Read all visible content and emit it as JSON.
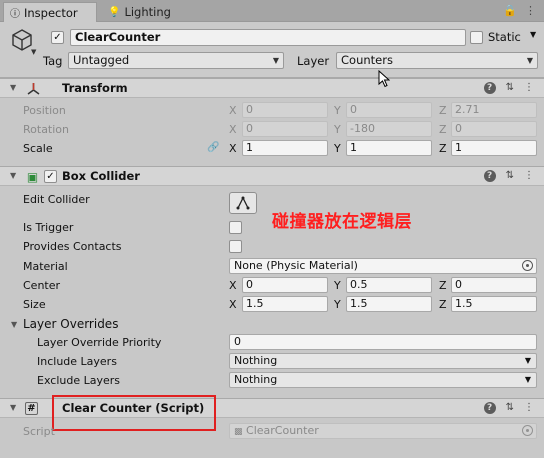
{
  "tabs": [
    {
      "label": "Inspector",
      "icon": "info-icon"
    },
    {
      "label": "Lighting",
      "icon": "light-bulb-icon"
    }
  ],
  "object": {
    "active_checked": true,
    "name": "ClearCounter",
    "static_label": "Static",
    "static_checked": false,
    "tag_label": "Tag",
    "tag_value": "Untagged",
    "layer_label": "Layer",
    "layer_value": "Counters"
  },
  "transform": {
    "title": "Transform",
    "position": {
      "label": "Position",
      "x": "0",
      "y": "0",
      "z": "2.71"
    },
    "rotation": {
      "label": "Rotation",
      "x": "0",
      "y": "-180",
      "z": "0"
    },
    "scale": {
      "label": "Scale",
      "x": "1",
      "y": "1",
      "z": "1"
    }
  },
  "box_collider": {
    "title": "Box Collider",
    "enabled": true,
    "edit_collider_label": "Edit Collider",
    "is_trigger_label": "Is Trigger",
    "provides_contacts_label": "Provides Contacts",
    "material_label": "Material",
    "material_value": "None (Physic Material)",
    "center": {
      "label": "Center",
      "x": "0",
      "y": "0.5",
      "z": "0"
    },
    "size": {
      "label": "Size",
      "x": "1.5",
      "y": "1.5",
      "z": "1.5"
    },
    "layer_overrides": {
      "label": "Layer Overrides",
      "priority_label": "Layer Override Priority",
      "priority_value": "0",
      "include_label": "Include Layers",
      "include_value": "Nothing",
      "exclude_label": "Exclude Layers",
      "exclude_value": "Nothing"
    }
  },
  "script_component": {
    "title": "Clear Counter (Script)",
    "script_label": "Script",
    "script_value": "ClearCounter"
  },
  "axes": {
    "x": "X",
    "y": "Y",
    "z": "Z"
  },
  "annotation": "碰撞器放在逻辑层",
  "colors": {
    "annotation": "#ff1f1f",
    "highlight_box": "#e02020"
  }
}
